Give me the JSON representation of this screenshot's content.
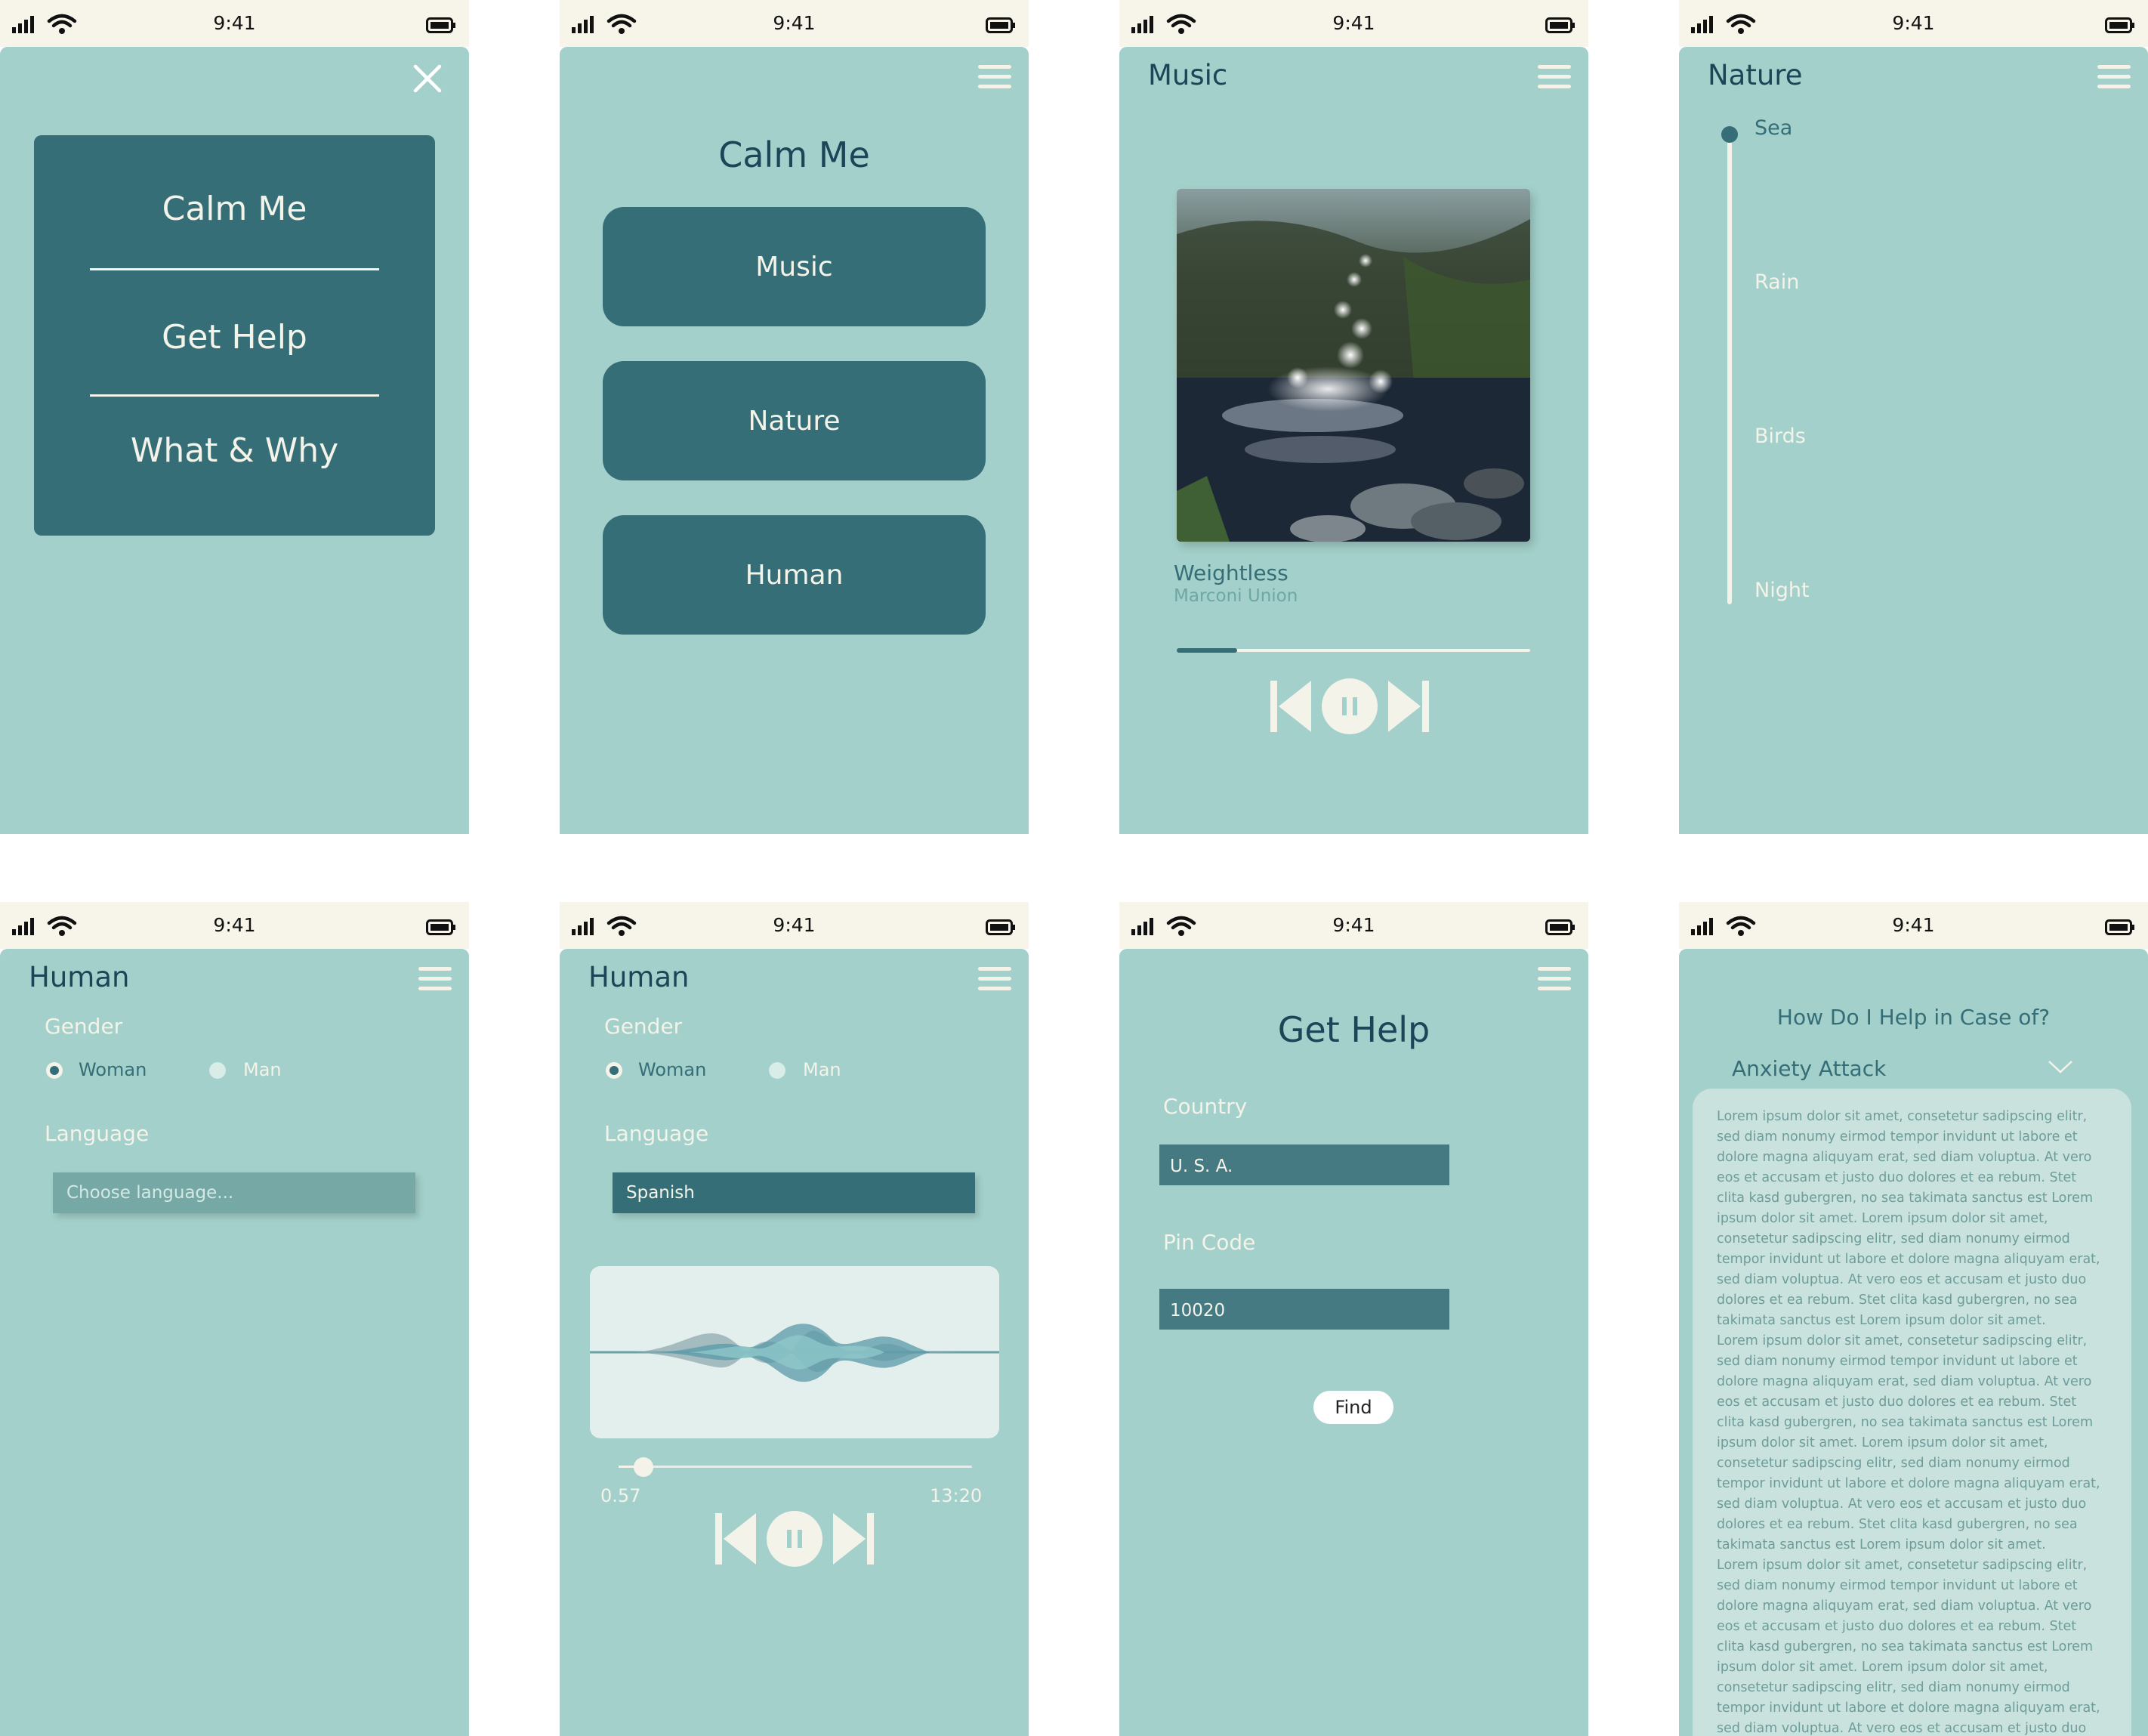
{
  "status_time": "9:41",
  "screen1": {
    "items": [
      "Calm Me",
      "Get Help",
      "What & Why"
    ]
  },
  "screen2": {
    "heading": "Calm Me",
    "buttons": [
      "Music",
      "Nature",
      "Human"
    ]
  },
  "music": {
    "title": "Music",
    "song": "Weightless",
    "artist": "Marconi Union",
    "progress": 0.17
  },
  "nature": {
    "title": "Nature",
    "options": [
      "Sea",
      "Rain",
      "Birds",
      "Night"
    ],
    "selected": "Sea"
  },
  "human1": {
    "title": "Human",
    "gender_label": "Gender",
    "option_woman": "Woman",
    "option_man": "Man",
    "selected_gender": "Woman",
    "language_label": "Language",
    "language_placeholder": "Choose language..."
  },
  "human2": {
    "title": "Human",
    "gender_label": "Gender",
    "option_woman": "Woman",
    "option_man": "Man",
    "selected_gender": "Woman",
    "language_label": "Language",
    "language_value": "Spanish",
    "time_current": "0.57",
    "time_total": "13:20",
    "progress": 0.07
  },
  "gethelp": {
    "title": "Get Help",
    "country_label": "Country",
    "country_value": "U. S. A.",
    "pin_label": "Pin Code",
    "pin_value": "10020",
    "find_label": "Find"
  },
  "faq": {
    "question": "How Do I Help in Case of?",
    "topic": "Anxiety Attack",
    "paragraphs": [
      "Lorem ipsum dolor sit amet, consetetur sadipscing elitr, sed diam nonumy eirmod tempor invidunt ut labore et dolore magna aliquyam erat, sed diam voluptua. At vero eos et accusam et justo duo dolores et ea rebum. Stet clita kasd gubergren, no sea takimata sanctus est Lorem ipsum dolor sit amet. Lorem ipsum dolor sit amet, consetetur sadipscing elitr, sed diam nonumy eirmod tempor invidunt ut labore et dolore magna aliquyam erat, sed diam voluptua. At vero eos et accusam et justo duo dolores et ea rebum. Stet clita kasd gubergren, no sea takimata sanctus est Lorem ipsum dolor sit amet.",
      "Lorem ipsum dolor sit amet, consetetur sadipscing elitr, sed diam nonumy eirmod tempor invidunt ut labore et dolore magna aliquyam erat, sed diam voluptua. At vero eos et accusam et justo duo dolores et ea rebum. Stet clita kasd gubergren, no sea takimata sanctus est Lorem ipsum dolor sit amet. Lorem ipsum dolor sit amet, consetetur sadipscing elitr, sed diam nonumy eirmod tempor invidunt ut labore et dolore magna aliquyam erat, sed diam voluptua. At vero eos et accusam et justo duo dolores et ea rebum. Stet clita kasd gubergren, no sea takimata sanctus est Lorem ipsum dolor sit amet.",
      "Lorem ipsum dolor sit amet, consetetur sadipscing elitr, sed diam nonumy eirmod tempor invidunt ut labore et dolore magna aliquyam erat, sed diam voluptua. At vero eos et accusam et justo duo dolores et ea rebum. Stet clita kasd gubergren, no sea takimata sanctus est Lorem ipsum dolor sit amet. Lorem ipsum dolor sit amet, consetetur sadipscing elitr, sed diam nonumy eirmod tempor invidunt ut labore et dolore magna aliquyam erat, sed diam voluptua. At vero eos et accusam et justo duo dolores et ea rebum. Stet clita kasd gubergren, no sea takimata sanctus est Lorem ipsum dolor sit amet."
    ]
  },
  "colors": {
    "background": "#a3d0ca",
    "primary": "#356e77",
    "cream": "#f3f3e9",
    "dark_text": "#1c4658"
  }
}
